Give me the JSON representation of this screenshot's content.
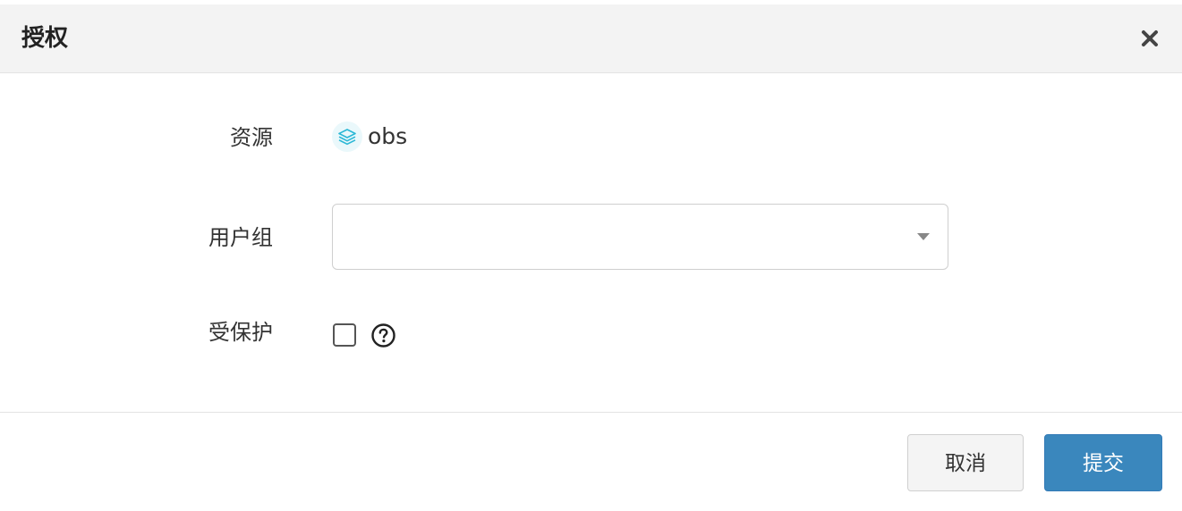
{
  "dialog": {
    "title": "授权",
    "close_icon": "close-icon"
  },
  "form": {
    "resource": {
      "label": "资源",
      "value": "obs",
      "icon": "layers-icon",
      "icon_color": "#2bb8d6"
    },
    "user_group": {
      "label": "用户组",
      "value": "",
      "icon": "caret-down-icon"
    },
    "protected": {
      "label": "受保护",
      "checked": false,
      "help_icon": "question-circle-icon"
    }
  },
  "footer": {
    "cancel_label": "取消",
    "submit_label": "提交",
    "submit_color": "#3a87bd"
  }
}
